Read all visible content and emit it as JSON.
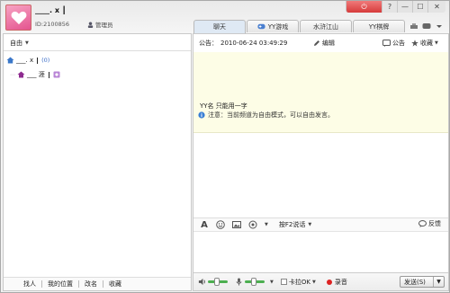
{
  "user": {
    "nickname": "____. x  ┃",
    "id_text": "ID:2100856",
    "role": "管理员"
  },
  "window_controls": {
    "power": "⏻",
    "help": "?",
    "min": "—",
    "max": "☐",
    "close": "✕"
  },
  "tabs": [
    {
      "label": "聊天",
      "active": true
    },
    {
      "label": "YY游戏",
      "active": false
    },
    {
      "label": "水浒江山",
      "active": false
    },
    {
      "label": "YY棋牌",
      "active": false
    }
  ],
  "left": {
    "mode_label": "自由",
    "channel_root": {
      "name": "___. x",
      "count": "(0)"
    },
    "channel_sub": {
      "name": "___ 涯"
    },
    "bottom_links": [
      "找人",
      "我的位置",
      "改名",
      "收藏"
    ]
  },
  "notice": {
    "label": "公告：",
    "time": "2010-06-24 03:49:29",
    "edit_label": "编辑",
    "gonggao_label": "公告",
    "collect_label": "收藏",
    "text": "YY名 只能用一字"
  },
  "info_message": "注意：当前频道为自由模式，可以自由发言。",
  "input_toolbar": {
    "mode_label": "按F2说话",
    "feedback_label": "反馈"
  },
  "bottom": {
    "karaoke_label": "卡拉OK",
    "record_label": "录音",
    "send_label": "发送(S)"
  },
  "colors": {
    "accent_blue": "#3a6cc8",
    "record_red": "#d22222",
    "notice_bg": "#fdfde6"
  }
}
